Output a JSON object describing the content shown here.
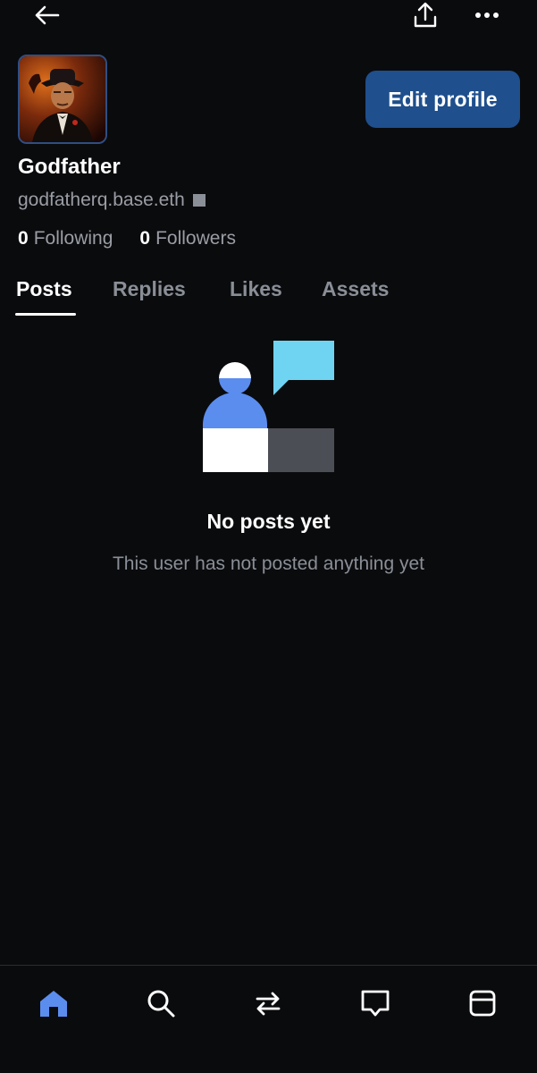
{
  "profile": {
    "display_name": "Godfather",
    "handle": "godfatherq.base.eth",
    "edit_label": "Edit profile",
    "following_count": "0",
    "following_label": "Following",
    "followers_count": "0",
    "followers_label": "Followers"
  },
  "tabs": [
    {
      "label": "Posts",
      "active": true
    },
    {
      "label": "Replies",
      "active": false
    },
    {
      "label": "Likes",
      "active": false
    },
    {
      "label": "Assets",
      "active": false
    }
  ],
  "empty_state": {
    "title": "No posts yet",
    "subtitle": "This user has not posted anything yet"
  },
  "icons": {
    "back": "arrow-left-icon",
    "share": "share-upload-icon",
    "more": "more-horizontal-icon",
    "nav": [
      "home-icon",
      "search-icon",
      "swap-icon",
      "messages-icon",
      "wallet-icon"
    ]
  },
  "colors": {
    "background": "#0a0b0d",
    "accent_button": "#1f4f8c",
    "active_nav": "#5b8def",
    "muted_text": "#8a8e96"
  }
}
